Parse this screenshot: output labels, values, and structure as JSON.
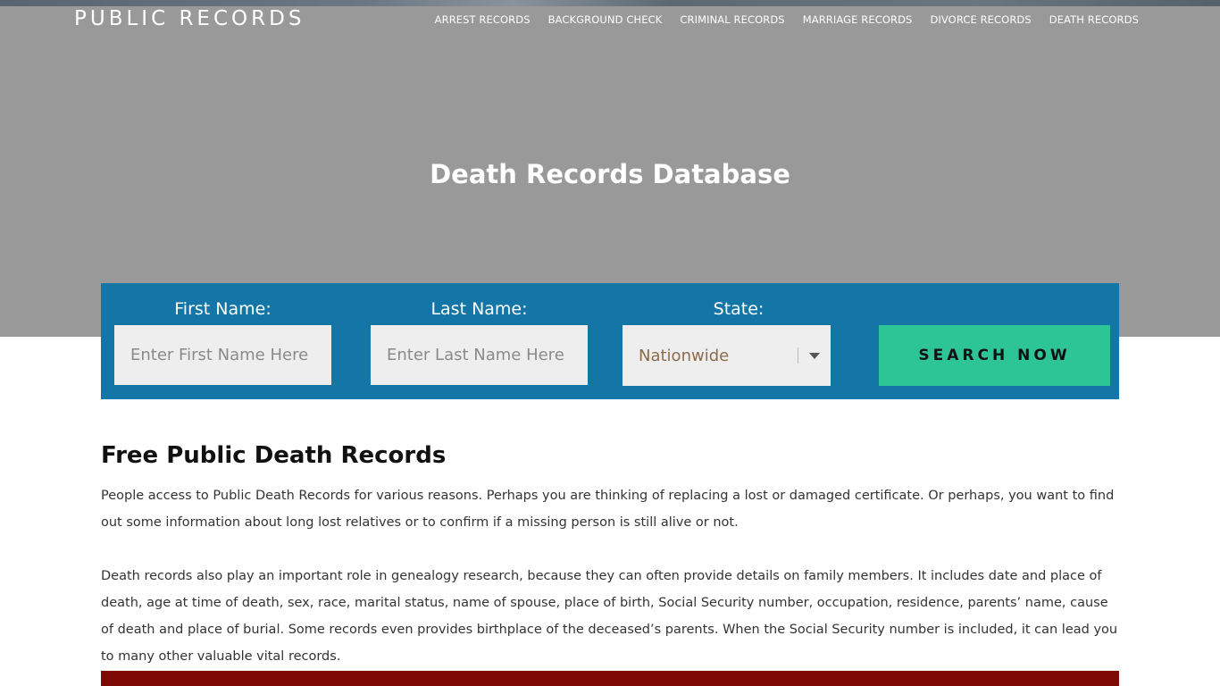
{
  "header": {
    "logo": "PUBLIC RECORDS",
    "nav": [
      "ARREST RECORDS",
      "BACKGROUND CHECK",
      "CRIMINAL RECORDS",
      "MARRIAGE RECORDS",
      "DIVORCE RECORDS",
      "DEATH RECORDS"
    ]
  },
  "hero": {
    "title": "Death Records Database"
  },
  "search": {
    "first_name_label": "First Name:",
    "first_name_placeholder": "Enter First Name Here",
    "last_name_label": "Last Name:",
    "last_name_placeholder": "Enter Last Name Here",
    "state_label": "State:",
    "state_value": "Nationwide",
    "button_label": "SEARCH NOW"
  },
  "content": {
    "heading": "Free Public Death Records",
    "paragraphs": [
      "People access to Public Death Records for various reasons. Perhaps you are thinking of replacing a lost or damaged certificate. Or perhaps, you want to find out some information about long lost relatives or to confirm if a missing person is still alive or not.",
      "Death records also play an important role in genealogy research, because they can often provide details on family members. It includes date and place of death, age at time of death, sex, race, marital status, name of spouse, place of birth, Social Security number, occupation, residence, parents’ name, cause of death and place of burial. Some records even provides birthplace of the deceased’s parents. When the Social Security number is included, it can lead you to many other valuable vital records."
    ]
  },
  "colors": {
    "hero_bg": "#999999",
    "search_bg": "#1476a6",
    "button_bg": "#2dc596",
    "band_bg": "#7d0a05"
  }
}
